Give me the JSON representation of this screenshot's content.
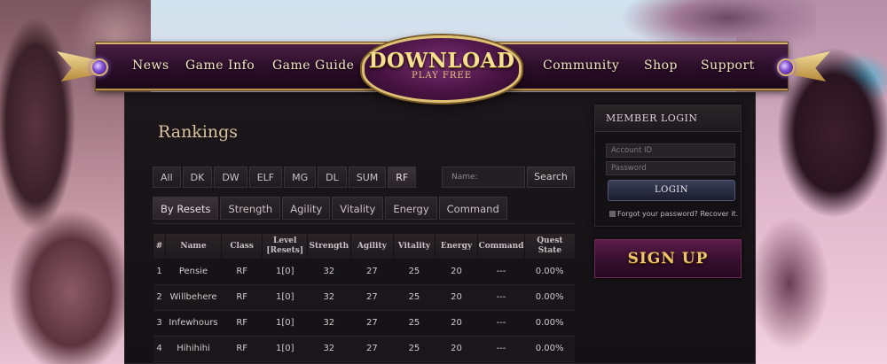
{
  "nav": {
    "items": [
      "News",
      "Game Info",
      "Game Guide",
      "Community",
      "Shop",
      "Support"
    ],
    "download_title": "DOWNLOAD",
    "download_sub": "PLAY FREE"
  },
  "page": {
    "title": "Rankings"
  },
  "class_tabs": [
    "All",
    "DK",
    "DW",
    "ELF",
    "MG",
    "DL",
    "SUM",
    "RF"
  ],
  "active_class_tab": "RF",
  "search": {
    "placeholder": "Name:",
    "button": "Search"
  },
  "sort_tabs": [
    "By Resets",
    "Strength",
    "Agility",
    "Vitality",
    "Energy",
    "Command"
  ],
  "active_sort_tab": "By Resets",
  "table": {
    "headers": [
      "#",
      "Name",
      "Class",
      "Level [Resets]",
      "Strength",
      "Agility",
      "Vitality",
      "Energy",
      "Command",
      "Quest State"
    ],
    "rows": [
      [
        "1",
        "Pensie",
        "RF",
        "1[0]",
        "32",
        "27",
        "25",
        "20",
        "---",
        "0.00%"
      ],
      [
        "2",
        "Willbehere",
        "RF",
        "1[0]",
        "32",
        "27",
        "25",
        "20",
        "---",
        "0.00%"
      ],
      [
        "3",
        "Infewhours",
        "RF",
        "1[0]",
        "32",
        "27",
        "25",
        "20",
        "---",
        "0.00%"
      ],
      [
        "4",
        "Hihihihi",
        "RF",
        "1[0]",
        "32",
        "27",
        "25",
        "20",
        "---",
        "0.00%"
      ]
    ]
  },
  "login": {
    "title": "Member Login",
    "account_placeholder": "Account ID",
    "password_placeholder": "Password",
    "button": "LOGIN",
    "forgot": "Forgot your password? Recover it."
  },
  "signup": {
    "label": "SIGN UP"
  },
  "colors": {
    "accent_gold": "#d9b76a",
    "panel_bg": "#141114",
    "nav_purple": "#2a0d28"
  }
}
